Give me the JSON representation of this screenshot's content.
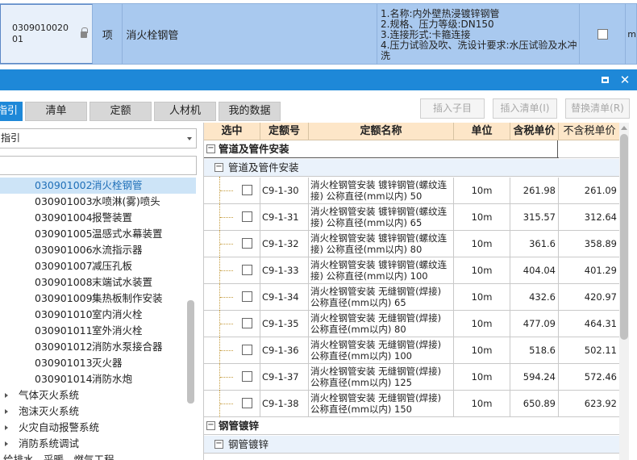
{
  "top_row": {
    "code": "030901002001",
    "type": "项",
    "name": "消火栓钢管",
    "features": "1.名称:内外壁热浸镀锌钢管\n2.规格、压力等级:DN150\n3.连接形式:卡箍连接\n4.压力试验及吹、洗设计要求:水压试验及水冲洗",
    "unit_partial": "m"
  },
  "titlebar": {
    "maximize_icon": "maximize-icon",
    "close_glyph": "✕"
  },
  "tabs": [
    "指引",
    "清单",
    "定额",
    "人材机",
    "我的数据"
  ],
  "actions": [
    "插入子目",
    "插入清单(I)",
    "替换清单(R)"
  ],
  "left_panel": {
    "select_value": "指引",
    "items": [
      {
        "code": "030901002",
        "name": "消火栓钢管"
      },
      {
        "code": "030901003",
        "name": "水喷淋(雾)喷头"
      },
      {
        "code": "030901004",
        "name": "报警装置"
      },
      {
        "code": "030901005",
        "name": "温感式水幕装置"
      },
      {
        "code": "030901006",
        "name": "水流指示器"
      },
      {
        "code": "030901007",
        "name": "减压孔板"
      },
      {
        "code": "030901008",
        "name": "末端试水装置"
      },
      {
        "code": "030901009",
        "name": "集热板制作安装"
      },
      {
        "code": "030901010",
        "name": "室内消火栓"
      },
      {
        "code": "030901011",
        "name": "室外消火栓"
      },
      {
        "code": "030901012",
        "name": "消防水泵接合器"
      },
      {
        "code": "030901013",
        "name": "灭火器"
      },
      {
        "code": "030901014",
        "name": "消防水炮"
      }
    ],
    "groups": [
      "气体灭火系统",
      "泡沫灭火系统",
      "火灾自动报警系统",
      "消防系统调试",
      "给排水、采暖、燃气工程"
    ]
  },
  "grid": {
    "headers": [
      "选中",
      "定额号",
      "定额名称",
      "单位",
      "含税单价",
      "不含税单价"
    ],
    "group1": "管道及管件安装",
    "group1_sub": "管道及管件安装",
    "rows": [
      {
        "code": "C9-1-30",
        "name": "消火栓钢管安装 镀锌钢管(螺纹连接) 公称直径(mm以内) 50",
        "unit": "10m",
        "tax": "261.98",
        "notax": "261.09"
      },
      {
        "code": "C9-1-31",
        "name": "消火栓钢管安装 镀锌钢管(螺纹连接) 公称直径(mm以内) 65",
        "unit": "10m",
        "tax": "315.57",
        "notax": "312.64"
      },
      {
        "code": "C9-1-32",
        "name": "消火栓钢管安装 镀锌钢管(螺纹连接) 公称直径(mm以内) 80",
        "unit": "10m",
        "tax": "361.6",
        "notax": "358.89"
      },
      {
        "code": "C9-1-33",
        "name": "消火栓钢管安装 镀锌钢管(螺纹连接) 公称直径(mm以内) 100",
        "unit": "10m",
        "tax": "404.04",
        "notax": "401.29"
      },
      {
        "code": "C9-1-34",
        "name": "消火栓钢管安装 无缝钢管(焊接) 公称直径(mm以内) 65",
        "unit": "10m",
        "tax": "432.6",
        "notax": "420.97"
      },
      {
        "code": "C9-1-35",
        "name": "消火栓钢管安装 无缝钢管(焊接) 公称直径(mm以内) 80",
        "unit": "10m",
        "tax": "477.09",
        "notax": "464.31"
      },
      {
        "code": "C9-1-36",
        "name": "消火栓钢管安装 无缝钢管(焊接) 公称直径(mm以内) 100",
        "unit": "10m",
        "tax": "518.6",
        "notax": "502.11"
      },
      {
        "code": "C9-1-37",
        "name": "消火栓钢管安装 无缝钢管(焊接) 公称直径(mm以内) 125",
        "unit": "10m",
        "tax": "594.24",
        "notax": "572.46"
      },
      {
        "code": "C9-1-38",
        "name": "消火栓钢管安装 无缝钢管(焊接) 公称直径(mm以内) 150",
        "unit": "10m",
        "tax": "650.89",
        "notax": "623.92"
      }
    ],
    "group2": "钢管镀锌",
    "group2_sub": "钢管镀锌"
  },
  "colors": {
    "accent": "#1e88d8",
    "row_highlight": "#a9c9ef",
    "header_bg": "#fde6c8",
    "tree_selected": "#cde4f7"
  }
}
